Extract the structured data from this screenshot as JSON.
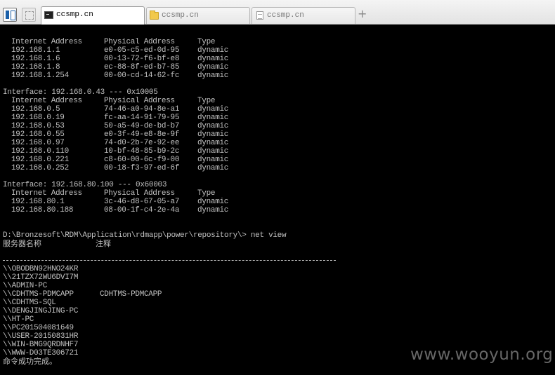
{
  "tabs": [
    {
      "label": "ccsmp.cn",
      "icon": "console-icon",
      "active": true
    },
    {
      "label": "ccsmp.cn",
      "icon": "folder-icon",
      "active": false
    },
    {
      "label": "ccsmp.cn",
      "icon": "document-icon",
      "active": false
    }
  ],
  "add_tab": "+",
  "arp": {
    "header": [
      "Internet Address",
      "Physical Address",
      "Type"
    ],
    "block1": [
      [
        "192.168.1.1",
        "e0-05-c5-ed-0d-95",
        "dynamic"
      ],
      [
        "192.168.1.6",
        "00-13-72-f6-bf-e8",
        "dynamic"
      ],
      [
        "192.168.1.8",
        "ec-88-8f-ed-b7-85",
        "dynamic"
      ],
      [
        "192.168.1.254",
        "00-00-cd-14-62-fc",
        "dynamic"
      ]
    ],
    "iface2": "Interface: 192.168.0.43 --- 0x10005",
    "block2": [
      [
        "192.168.0.5",
        "74-46-a0-94-8e-a1",
        "dynamic"
      ],
      [
        "192.168.0.19",
        "fc-aa-14-91-79-95",
        "dynamic"
      ],
      [
        "192.168.0.53",
        "50-a5-49-de-bd-b7",
        "dynamic"
      ],
      [
        "192.168.0.55",
        "e0-3f-49-e8-8e-9f",
        "dynamic"
      ],
      [
        "192.168.0.97",
        "74-d0-2b-7e-92-ee",
        "dynamic"
      ],
      [
        "192.168.0.110",
        "10-bf-48-85-b9-2c",
        "dynamic"
      ],
      [
        "192.168.0.221",
        "c8-60-00-6c-f9-00",
        "dynamic"
      ],
      [
        "192.168.0.252",
        "00-18-f3-97-ed-6f",
        "dynamic"
      ]
    ],
    "iface3": "Interface: 192.168.80.100 --- 0x60003",
    "block3": [
      [
        "192.168.80.1",
        "3c-46-d8-67-05-a7",
        "dynamic"
      ],
      [
        "192.168.80.188",
        "08-00-1f-c4-2e-4a",
        "dynamic"
      ]
    ]
  },
  "netview": {
    "prompt": "D:\\Bronzesoft\\RDM\\Application\\rdmapp\\power\\repository\\> net view",
    "col_server": "服务器名称",
    "col_remark": "注释",
    "servers": [
      {
        "name": "\\\\OBODBN92HNO24KR",
        "remark": ""
      },
      {
        "name": "\\\\21TZX72WU6DVI7M",
        "remark": ""
      },
      {
        "name": "\\\\ADMIN-PC",
        "remark": ""
      },
      {
        "name": "\\\\CDHTMS-PDMCAPP",
        "remark": "CDHTMS-PDMCAPP"
      },
      {
        "name": "\\\\CDHTMS-SQL",
        "remark": ""
      },
      {
        "name": "\\\\DENGJINGJING-PC",
        "remark": ""
      },
      {
        "name": "\\\\HT-PC",
        "remark": ""
      },
      {
        "name": "\\\\PC201504081649",
        "remark": ""
      },
      {
        "name": "\\\\USER-20150831HR",
        "remark": ""
      },
      {
        "name": "\\\\WIN-BMG9QRDNHF7",
        "remark": ""
      },
      {
        "name": "\\\\WWW-D03TE306721",
        "remark": ""
      }
    ],
    "done": "命令成功完成。"
  },
  "watermark": "www.wooyun.org"
}
